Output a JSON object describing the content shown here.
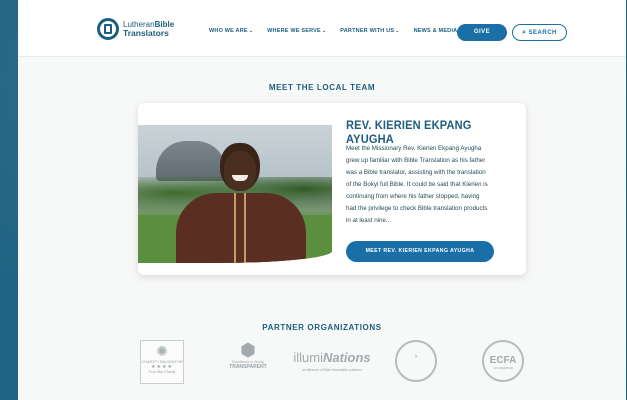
{
  "header": {
    "logo": {
      "line1_light": "Lutheran",
      "line1_bold": "Bible",
      "line2": "Translators"
    },
    "nav": [
      {
        "label": "WHO WE ARE"
      },
      {
        "label": "WHERE WE SERVE"
      },
      {
        "label": "PARTNER WITH US"
      },
      {
        "label": "NEWS & MEDIA"
      }
    ],
    "give_label": "GIVE",
    "search_label": "SEARCH"
  },
  "team_section": {
    "title": "MEET THE LOCAL TEAM",
    "person_name": "REV. KIERIEN EKPANG AYUGHA",
    "bio": "Meet the Missionary Rev. Kierien Ekpang Ayugha grew up familiar with Bible Translation as his father was a Bible translator, assisting with the translation of the Bokyi full Bible. It could be said that Kierien is continuing from where his father stopped, having had the privilege to check Bible translation products in at least nine...",
    "button_label": "MEET REV. KIERIEN EKPANG AYUGHA"
  },
  "partners_section": {
    "title": "PARTNER ORGANIZATIONS",
    "charity_navigator": {
      "line1": "CHARITY NAVIGATOR",
      "stars": "★★★★",
      "line2": "Four Star Charity"
    },
    "transparent": {
      "line1": "Excellence in Giving",
      "line2": "TRANSPARENT"
    },
    "illuminations": {
      "word_light": "illumi",
      "word_bold": "Nations",
      "tagline": "an alliance of Bible translation partners"
    },
    "ecfa": {
      "name": "ECFA",
      "sub": "ACCREDITED"
    }
  },
  "colors": {
    "brand": "#1c5e80",
    "button": "#1a6fa6",
    "background": "#1f6283"
  }
}
